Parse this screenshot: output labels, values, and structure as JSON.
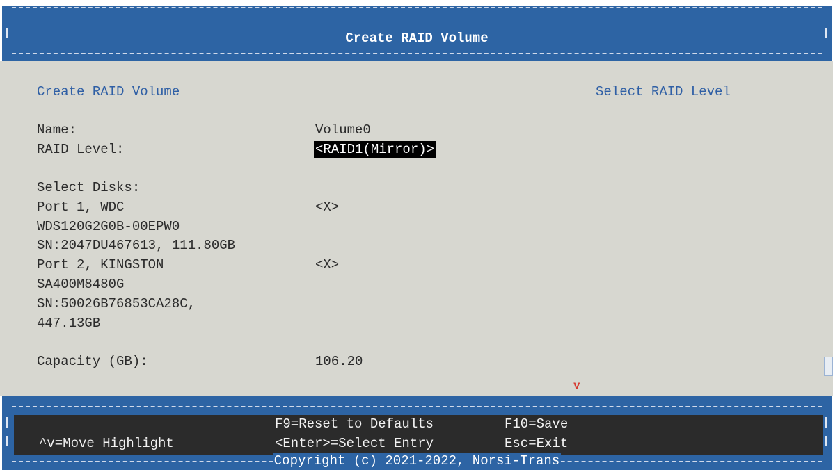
{
  "header": {
    "title": "Create RAID Volume"
  },
  "form": {
    "section_title": "Create RAID Volume",
    "help_text": "Select RAID Level",
    "name_label": "Name:",
    "name_value": "Volume0",
    "raid_level_label": "RAID Level:",
    "raid_level_value": "<RAID1(Mirror)>",
    "select_disks_label": "Select Disks:",
    "disks": [
      {
        "line1": "Port 1, WDC",
        "line2": "WDS120G2G0B-00EPW0",
        "line3": "SN:2047DU467613, 111.80GB",
        "line4": "",
        "checkbox": "<X>"
      },
      {
        "line1": "Port 2, KINGSTON",
        "line2": "SA400M8480G",
        "line3": "SN:50026B76853CA28C,",
        "line4": "447.13GB",
        "checkbox": "<X>"
      }
    ],
    "capacity_label": "Capacity (GB):",
    "capacity_value": "106.20",
    "more_indicator": "v"
  },
  "footer": {
    "f9": "F9=Reset to Defaults",
    "f10": "F10=Save",
    "move": "^v=Move Highlight",
    "enter": "<Enter>=Select Entry",
    "esc": "Esc=Exit",
    "copyright": "Copyright (c) 2021-2022, Norsi-Trans"
  }
}
